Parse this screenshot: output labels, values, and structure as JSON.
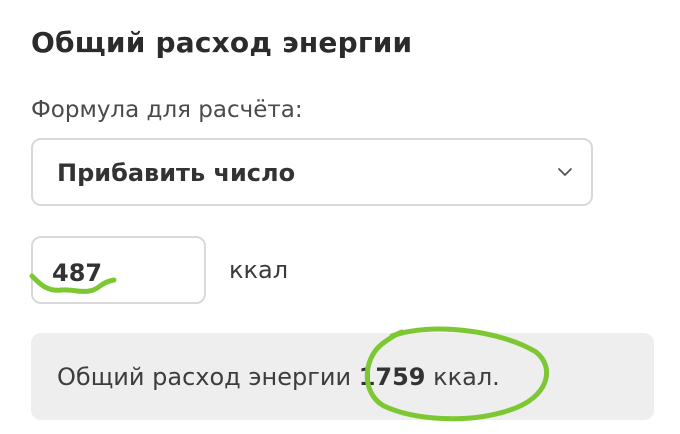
{
  "section": {
    "title": "Общий расход энергии"
  },
  "formula": {
    "label": "Формула для расчёта:",
    "selected": "Прибавить число"
  },
  "input": {
    "value": "487",
    "unit": "ккал"
  },
  "result": {
    "prefix": "Общий расход энергии",
    "value": "1759",
    "unit": "ккал."
  },
  "colors": {
    "highlight": "#7dc832",
    "result_bg": "#eeeeef",
    "border": "#d9d9d9"
  },
  "icons": {
    "dropdown": "chevron-down-icon"
  }
}
